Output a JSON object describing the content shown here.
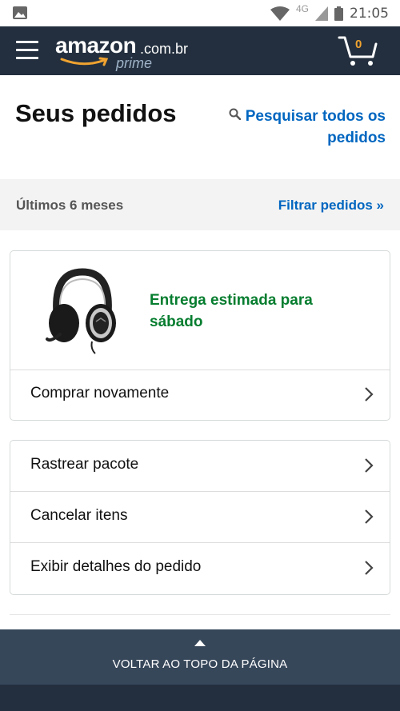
{
  "status_bar": {
    "time": "21:05",
    "network": "4G"
  },
  "header": {
    "logo_main": "amazon",
    "logo_domain": ".com.br",
    "logo_prime": "prime",
    "cart_count": "0"
  },
  "page": {
    "title": "Seus pedidos",
    "search_all_label": "Pesquisar todos os pedidos"
  },
  "filter": {
    "period": "Últimos 6 meses",
    "filter_link": "Filtrar pedidos »"
  },
  "order": {
    "delivery_status": "Entrega estimada para sábado",
    "buy_again": "Comprar novamente"
  },
  "actions": [
    {
      "label": "Rastrear pacote"
    },
    {
      "label": "Cancelar itens"
    },
    {
      "label": "Exibir detalhes do pedido"
    }
  ],
  "footer": {
    "back_to_top": "VOLTAR AO TOPO DA PÁGINA"
  },
  "colors": {
    "header_bg": "#232f3e",
    "link": "#0066c0",
    "delivery_green": "#067d2f",
    "backtop_bg": "#37475a",
    "cart_accent": "#f0a330"
  }
}
